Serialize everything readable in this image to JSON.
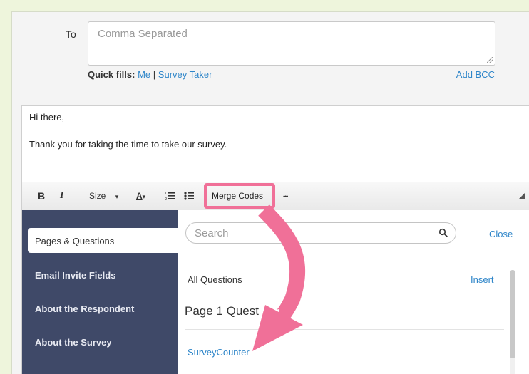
{
  "compose": {
    "to_label": "To",
    "to_placeholder": "Comma Separated",
    "quick_fills_label": "Quick fills:",
    "quick_me": "Me",
    "quick_sep": "|",
    "quick_survey_taker": "Survey Taker",
    "add_bcc": "Add BCC"
  },
  "editor": {
    "line1": "Hi there,",
    "line2": "Thank you for taking the time to take our survey."
  },
  "toolbar": {
    "bold": "B",
    "italic": "I",
    "size": "Size",
    "font_color": "A",
    "merge_codes": "Merge Codes",
    "more": "•••"
  },
  "merge_panel": {
    "sidebar": {
      "active": "Pages & Questions",
      "items": [
        "Email Invite Fields",
        "About the Respondent",
        "About the Survey"
      ]
    },
    "search_placeholder": "Search",
    "close": "Close",
    "all_questions": "All Questions",
    "insert": "Insert",
    "page_heading": "Page 1 Quest",
    "first_item": "SurveyCounter"
  },
  "colors": {
    "link": "#2f86c9",
    "sidebar_bg": "#3f4968",
    "highlight": "#f07098",
    "page_bg": "#eef5dc"
  }
}
